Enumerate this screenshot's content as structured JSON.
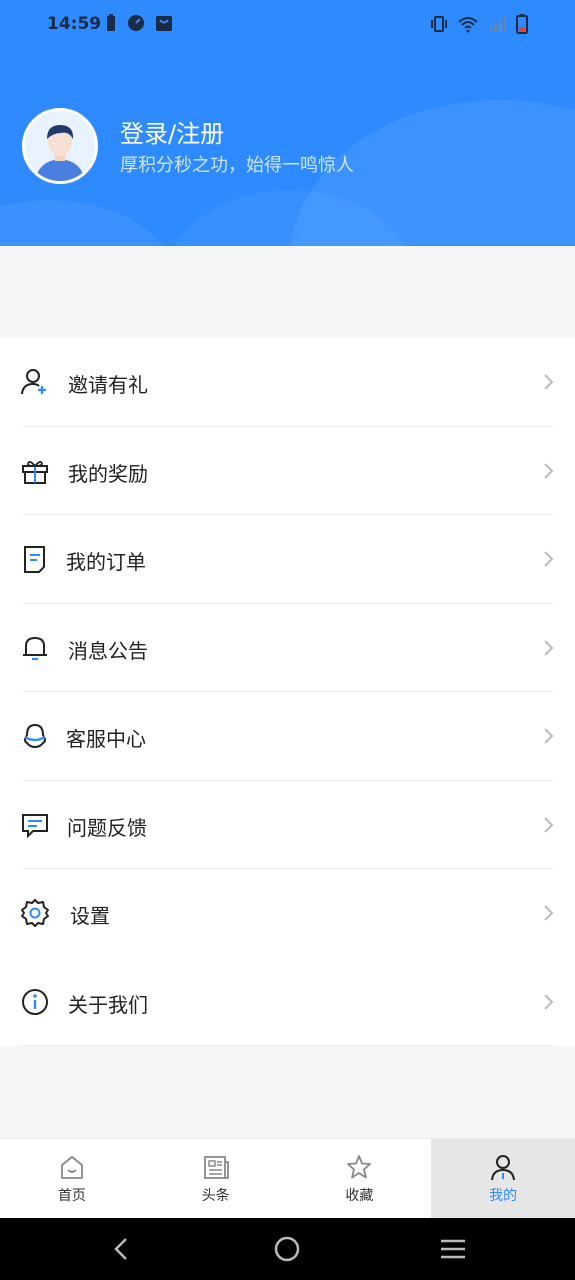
{
  "status_bar": {
    "time": "14:59"
  },
  "header": {
    "login_title": "登录/注册",
    "login_subtitle": "厚积分秒之功，始得一鸣惊人",
    "bg_color": "#2e8bff"
  },
  "menu": [
    {
      "label": "邀请有礼",
      "icon": "add-user-icon"
    },
    {
      "label": "我的奖励",
      "icon": "gift-icon"
    },
    {
      "label": "我的订单",
      "icon": "document-icon"
    },
    {
      "label": "消息公告",
      "icon": "bell-icon"
    },
    {
      "label": "客服中心",
      "icon": "support-icon"
    },
    {
      "label": "问题反馈",
      "icon": "chat-icon"
    },
    {
      "label": "设置",
      "icon": "gear-icon"
    },
    {
      "label": "关于我们",
      "icon": "info-icon"
    }
  ],
  "tabbar": [
    {
      "label": "首页",
      "icon": "home-icon"
    },
    {
      "label": "头条",
      "icon": "news-icon"
    },
    {
      "label": "收藏",
      "icon": "star-icon"
    },
    {
      "label": "我的",
      "icon": "user-icon",
      "active": true
    }
  ],
  "accent_color": "#2e8bff"
}
